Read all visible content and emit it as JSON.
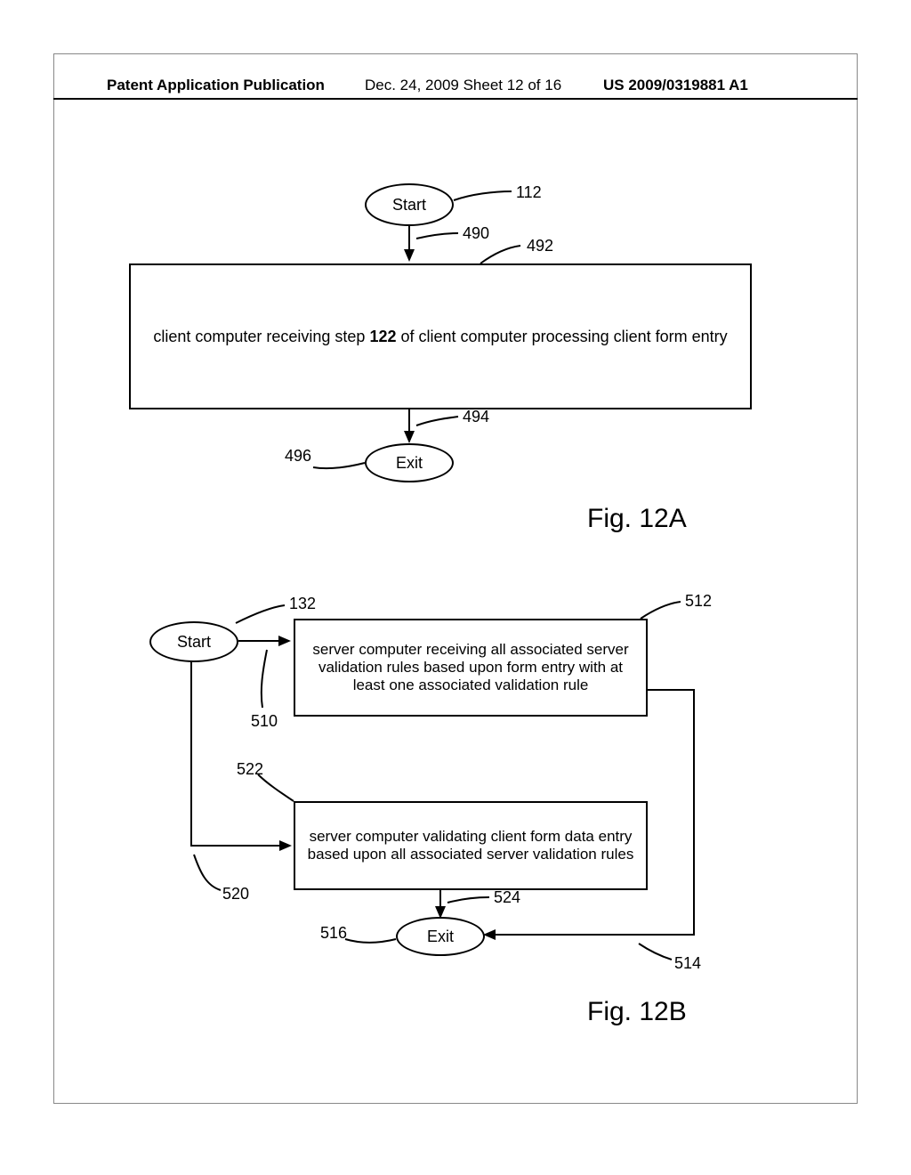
{
  "header": {
    "left": "Patent Application Publication",
    "center": "Dec. 24, 2009  Sheet 12 of 16",
    "right": "US 2009/0319881 A1"
  },
  "fig12a": {
    "start": "Start",
    "exit": "Exit",
    "box_pre": "client computer receiving step ",
    "box_bold": "122",
    "box_post": " of client computer processing client form entry",
    "refs": {
      "top": "112",
      "arrow_top": "490",
      "box": "492",
      "arrow_bot": "494",
      "exit": "496"
    },
    "caption": "Fig. 12A"
  },
  "fig12b": {
    "start": "Start",
    "exit": "Exit",
    "box1": "server computer receiving all associated server validation rules based upon form entry with at least one associated validation rule",
    "box2": "server computer validating client form data entry based upon all associated server validation rules",
    "refs": {
      "start": "132",
      "arrow_start": "510",
      "box1": "512",
      "box2_line": "522",
      "lline": "520",
      "exit": "516",
      "arrow_exit": "524",
      "rline": "514"
    },
    "caption": "Fig. 12B"
  }
}
